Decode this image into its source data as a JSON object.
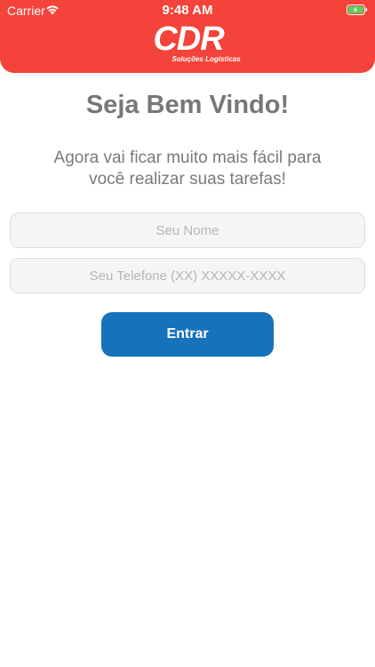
{
  "status_bar": {
    "carrier": "Carrier",
    "time": "9:48 AM"
  },
  "header": {
    "brand_color": "#f4433a",
    "logo_text": "CDR",
    "logo_tagline": "Soluções Logísticas"
  },
  "main": {
    "welcome_title": "Seja Bem Vindo!",
    "subtitle": "Agora vai ficar muito mais fácil para você realizar suas tarefas!",
    "name_placeholder": "Seu Nome",
    "phone_placeholder": "Seu Telefone (XX) XXXXX-XXXX",
    "enter_label": "Entrar",
    "button_color": "#1673bb"
  },
  "icons": {
    "wifi": "wifi-icon",
    "battery": "battery-charging-icon"
  }
}
